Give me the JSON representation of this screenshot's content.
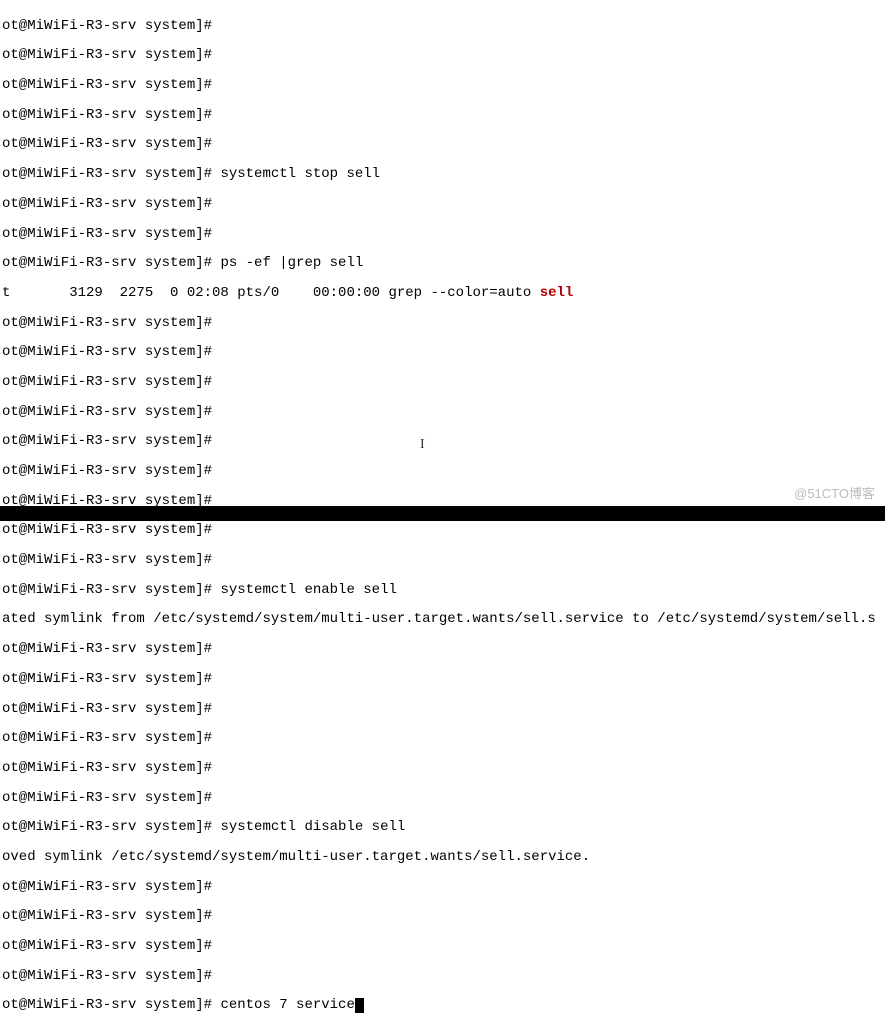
{
  "prompt": "ot@MiWiFi-R3-srv system]# ",
  "prompt_short": "ot@MiWiFi-R3-srv system]#",
  "cmd_stop": "systemctl stop sell",
  "cmd_ps": "ps -ef |grep sell",
  "ps_line_a": "t       3129  2275  0 02:08 pts/0    00:00:00 grep --color=auto ",
  "ps_match": "sell",
  "cmd_enable": "systemctl enable sell",
  "enable_out": "ated symlink from /etc/systemd/system/multi-user.target.wants/sell.service to /etc/systemd/system/sell.s",
  "cmd_disable": "systemctl disable sell",
  "disable_out": "oved symlink /etc/systemd/system/multi-user.target.wants/sell.service.",
  "cmd_current": "centos 7 service",
  "watermark": "@51CTO博客",
  "ibeam": "I"
}
